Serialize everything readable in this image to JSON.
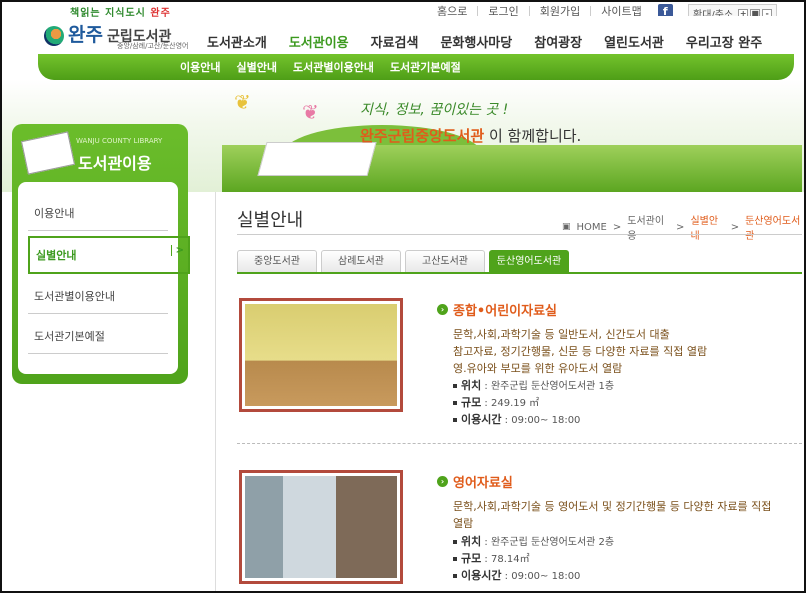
{
  "util": {
    "links": [
      "홈으로",
      "로그인",
      "회원가입",
      "사이트맵"
    ],
    "facebook": "f",
    "zoom_label": "확대/축소",
    "zoom_buttons": [
      "+",
      "■",
      "-"
    ]
  },
  "logo": {
    "slogan_a": "책읽는 지식도시",
    "slogan_b": "완주",
    "name_main": "완주",
    "name_sub": "군립도서관",
    "subtitle": "중앙/삼례/고산/둔산영어"
  },
  "gnb": [
    "도서관소개",
    "도서관이용",
    "자료검색",
    "문화행사마당",
    "참여광장",
    "열린도서관",
    "우리고장 완주"
  ],
  "snb": [
    "이용안내",
    "실별안내",
    "도서관별이용안내",
    "도서관기본예절"
  ],
  "banner": {
    "line1": "지식, 정보, 꿈이있는 곳 !",
    "line2_highlight": "완주군립중앙도서관",
    "line2_rest": "이 함께합니다."
  },
  "lnb": {
    "caption": "WANJU COUNTY LIBRARY",
    "title": "도서관이용",
    "items": [
      "이용안내",
      "실별안내",
      "도서관별이용안내",
      "도서관기본예절"
    ],
    "active_arrow": ">"
  },
  "page": {
    "title": "실별안내",
    "breadcrumb": {
      "home": "HOME",
      "sep": ">",
      "b1": "도서관이용",
      "b2": "실별안내",
      "b3": "둔산영어도서관"
    }
  },
  "tabs": [
    "중앙도서관",
    "삼례도서관",
    "고산도서관",
    "둔산영어도서관"
  ],
  "rooms": [
    {
      "title": "종합•어린이자료실",
      "desc": [
        "문학,사회,과학기술 등 일반도서, 신간도서 대출",
        "참고자료, 정기간행물, 신문 등 다양한 자료를 직접 열람",
        "영.유아와 부모를 위한 유아도서 열람"
      ],
      "loc_label": "위치",
      "loc": "완주군립 둔산영어도서관 1층",
      "size_label": "규모",
      "size": "249.19 ㎡",
      "hours_label": "이용시간",
      "hours": "09:00~ 18:00"
    },
    {
      "title": "영어자료실",
      "desc": [
        "문학,사회,과학기술 등 영어도서 및 정기간행물 등 다양한 자료를 직접",
        "열람"
      ],
      "loc_label": "위치",
      "loc": "완주군립 둔산영어도서관 2층",
      "size_label": "규모",
      "size": "78.14㎡",
      "hours_label": "이용시간",
      "hours": "09:00~ 18:00"
    }
  ]
}
